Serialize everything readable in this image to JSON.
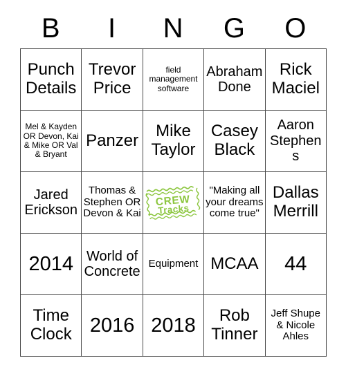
{
  "card": {
    "header_letters": [
      "B",
      "I",
      "N",
      "G",
      "O"
    ],
    "rows": [
      [
        {
          "text": "Punch Details",
          "size": "sz-xl",
          "type": "text"
        },
        {
          "text": "Trevor Price",
          "size": "sz-xl",
          "type": "text"
        },
        {
          "text": "field management software",
          "size": "sz-s",
          "type": "text"
        },
        {
          "text": "Abraham Done",
          "size": "sz-l",
          "type": "text"
        },
        {
          "text": "Rick Maciel",
          "size": "sz-xl",
          "type": "text"
        }
      ],
      [
        {
          "text": "Mel & Kayden OR Devon, Kai & Mike OR Val & Bryant",
          "size": "sz-s",
          "type": "text"
        },
        {
          "text": "Panzer",
          "size": "sz-xl",
          "type": "text"
        },
        {
          "text": "Mike Taylor",
          "size": "sz-xl",
          "type": "text"
        },
        {
          "text": "Casey Black",
          "size": "sz-xl",
          "type": "text"
        },
        {
          "text": "Aaron Stephens",
          "size": "sz-l",
          "type": "text"
        }
      ],
      [
        {
          "text": "Jared Erickson",
          "size": "sz-l",
          "type": "text"
        },
        {
          "text": "Thomas & Stephen OR Devon & Kai",
          "size": "sz-m",
          "type": "text"
        },
        {
          "text": "CrewTracks",
          "size": "sz-m",
          "type": "logo"
        },
        {
          "text": "\"Making all your dreams come true\"",
          "size": "sz-m",
          "type": "text"
        },
        {
          "text": "Dallas Merrill",
          "size": "sz-xl",
          "type": "text"
        }
      ],
      [
        {
          "text": "2014",
          "size": "sz-xxl",
          "type": "text"
        },
        {
          "text": "World of Concrete",
          "size": "sz-l",
          "type": "text"
        },
        {
          "text": "Equipment",
          "size": "sz-m",
          "type": "text"
        },
        {
          "text": "MCAA",
          "size": "sz-xl",
          "type": "text"
        },
        {
          "text": "44",
          "size": "sz-xxl",
          "type": "text"
        }
      ],
      [
        {
          "text": "Time Clock",
          "size": "sz-xl",
          "type": "text"
        },
        {
          "text": "2016",
          "size": "sz-xxl",
          "type": "text"
        },
        {
          "text": "2018",
          "size": "sz-xxl",
          "type": "text"
        },
        {
          "text": "Rob Tinner",
          "size": "sz-xl",
          "type": "text"
        },
        {
          "text": "Jeff Shupe & Nicole Ahles",
          "size": "sz-m",
          "type": "text"
        }
      ]
    ],
    "free_space": {
      "logo_name": "crewtracks-logo",
      "logo_line1": "CREW",
      "logo_line2": "Tracks",
      "logo_color": "#8CC63F"
    },
    "colors": {
      "border": "#4a4a4a",
      "text": "#000000",
      "background": "#ffffff",
      "logo_green": "#8CC63F"
    }
  }
}
